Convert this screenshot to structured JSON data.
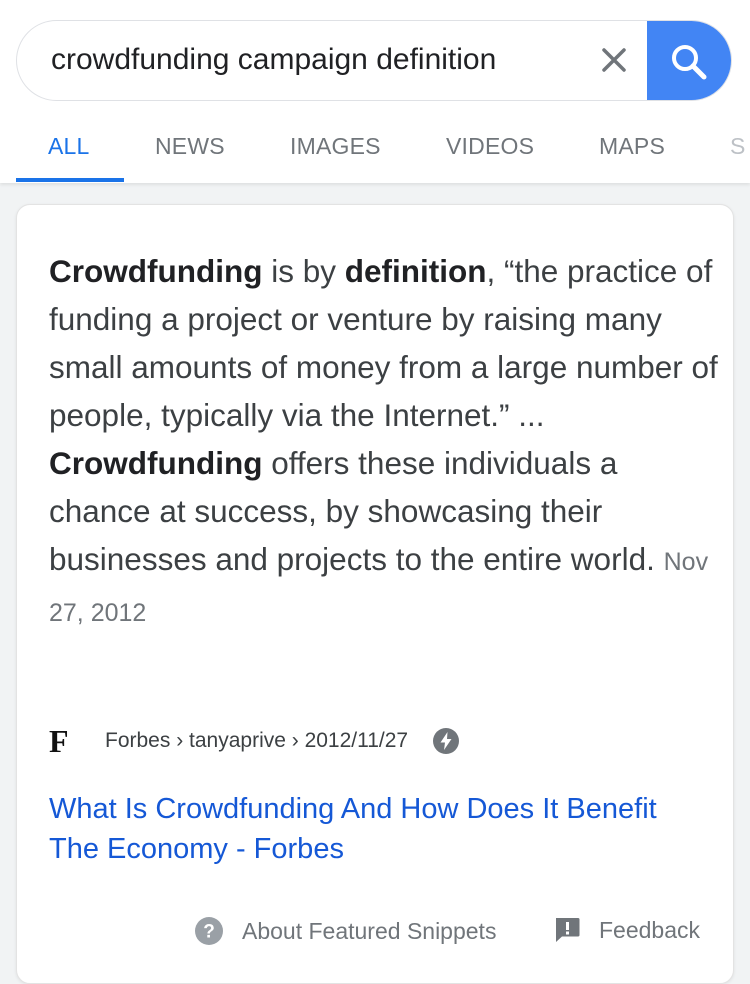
{
  "search": {
    "query": "crowdfunding campaign definition",
    "clear_icon": "close-icon",
    "search_icon": "search-icon",
    "accent_color": "#4285f4"
  },
  "tabs": [
    {
      "label": "ALL",
      "active": true
    },
    {
      "label": "NEWS",
      "active": false
    },
    {
      "label": "IMAGES",
      "active": false
    },
    {
      "label": "VIDEOS",
      "active": false
    },
    {
      "label": "MAPS",
      "active": false
    },
    {
      "label": "S",
      "active": false
    }
  ],
  "snippet": {
    "parts": [
      {
        "text": "Crowdfunding",
        "bold": true
      },
      {
        "text": " is by ",
        "bold": false
      },
      {
        "text": "definition",
        "bold": true
      },
      {
        "text": ", “the practice of funding a project or venture by raising many small amounts of money from a large number of people, typically via the Internet.” ... ",
        "bold": false
      },
      {
        "text": "Crowdfunding",
        "bold": true
      },
      {
        "text": " offers these individuals a chance at success, by showcasing their businesses and projects to the entire world.",
        "bold": false
      }
    ],
    "date": "Nov 27, 2012"
  },
  "source": {
    "logo_letter": "F",
    "path": "Forbes › tanyaprive › 2012/11/27",
    "amp_icon": "amp-lightning-icon"
  },
  "result": {
    "title": "What Is Crowdfunding And How Does It Benefit The Economy - Forbes"
  },
  "footer": {
    "about_label": "About Featured Snippets",
    "feedback_label": "Feedback"
  }
}
